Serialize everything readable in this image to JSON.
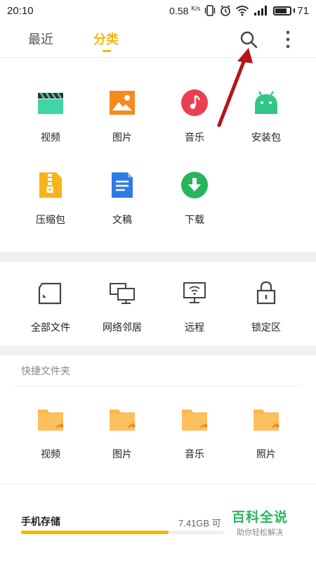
{
  "status_bar": {
    "time": "20:10",
    "speed": "0.58",
    "speed_unit": "K/s",
    "battery": "71",
    "battery_level": 0.71
  },
  "header": {
    "tabs": [
      {
        "label": "最近",
        "active": false
      },
      {
        "label": "分类",
        "active": true
      }
    ],
    "accent_color": "#f5b800"
  },
  "categories": [
    {
      "label": "视频",
      "icon": "video-clapper-icon"
    },
    {
      "label": "图片",
      "icon": "image-icon"
    },
    {
      "label": "音乐",
      "icon": "music-icon"
    },
    {
      "label": "安装包",
      "icon": "android-icon"
    },
    {
      "label": "压缩包",
      "icon": "zip-icon"
    },
    {
      "label": "文稿",
      "icon": "document-icon"
    },
    {
      "label": "下载",
      "icon": "download-icon"
    }
  ],
  "tools": [
    {
      "label": "全部文件",
      "icon": "sd-card-icon"
    },
    {
      "label": "网络邻居",
      "icon": "network-computers-icon"
    },
    {
      "label": "远程",
      "icon": "remote-monitor-icon"
    },
    {
      "label": "锁定区",
      "icon": "lock-icon"
    }
  ],
  "quick_folders": {
    "title": "快捷文件夹",
    "items": [
      {
        "label": "视频"
      },
      {
        "label": "图片"
      },
      {
        "label": "音乐"
      },
      {
        "label": "照片"
      }
    ]
  },
  "storage": {
    "title": "手机存储",
    "size": "7.41GB 可",
    "used_fraction": 0.7
  },
  "watermark": {
    "title": "百科全说",
    "subtitle": "助你轻松解决"
  }
}
